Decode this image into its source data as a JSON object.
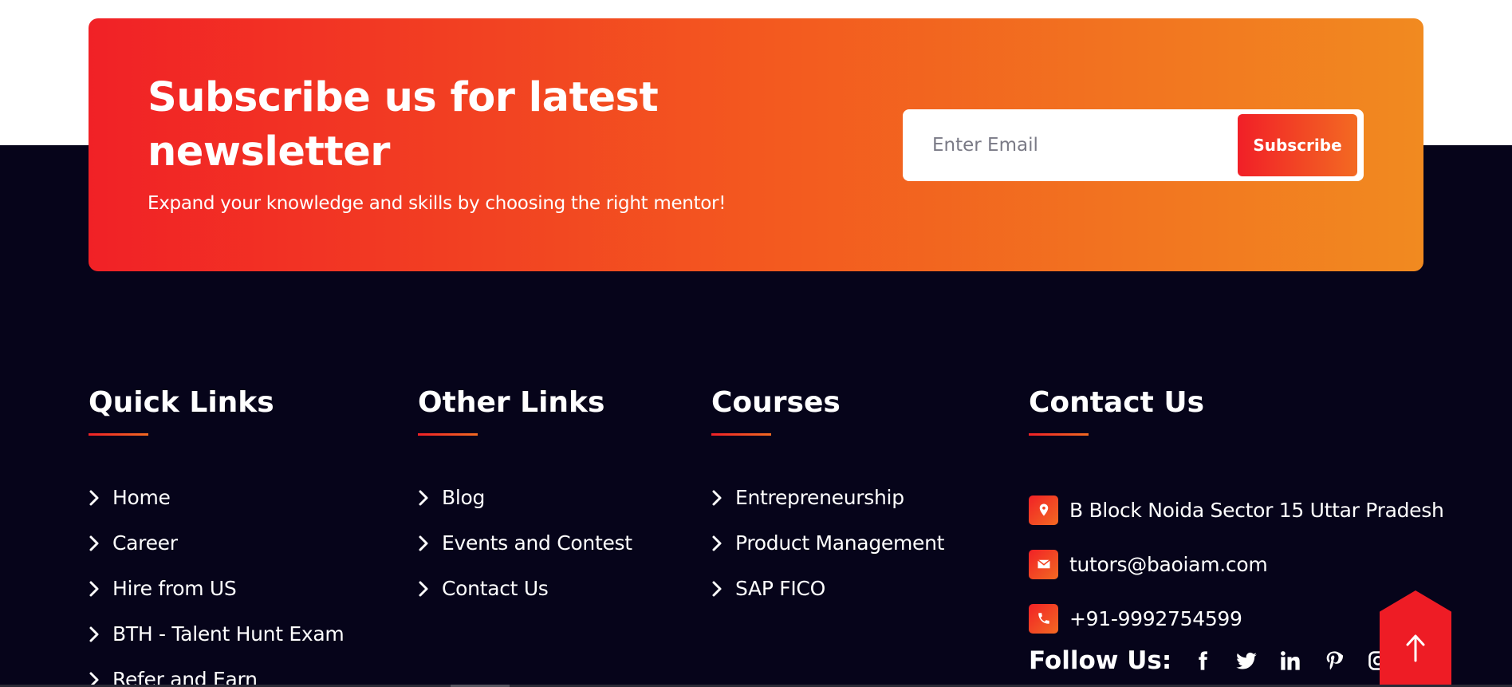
{
  "newsletter": {
    "title": "Subscribe us for latest newsletter",
    "subtitle": "Expand your knowledge and skills by choosing the right mentor!",
    "email_placeholder": "Enter Email",
    "button_label": "Subscribe"
  },
  "quick_links": {
    "title": "Quick Links",
    "items": [
      {
        "label": "Home"
      },
      {
        "label": "Career"
      },
      {
        "label": "Hire from US"
      },
      {
        "label": "BTH - Talent Hunt Exam"
      },
      {
        "label": "Refer and Earn"
      }
    ]
  },
  "other_links": {
    "title": "Other Links",
    "items": [
      {
        "label": "Blog"
      },
      {
        "label": "Events and Contest"
      },
      {
        "label": "Contact Us"
      }
    ]
  },
  "courses": {
    "title": "Courses",
    "items": [
      {
        "label": "Entrepreneurship"
      },
      {
        "label": "Product Management"
      },
      {
        "label": "SAP FICO"
      }
    ]
  },
  "contact": {
    "title": "Contact Us",
    "address": "B Block Noida Sector 15 Uttar Pradesh",
    "email": "tutors@baoiam.com",
    "phone": "+91-9992754599",
    "follow_label": "Follow Us:",
    "socials": [
      "facebook-icon",
      "twitter-icon",
      "linkedin-icon",
      "pinterest-icon",
      "instagram-icon"
    ]
  },
  "colors": {
    "accent_start": "#f12126",
    "accent_end": "#f18a20",
    "footer_bg": "#06041a",
    "scroll_top_bg": "#ee1c25"
  }
}
